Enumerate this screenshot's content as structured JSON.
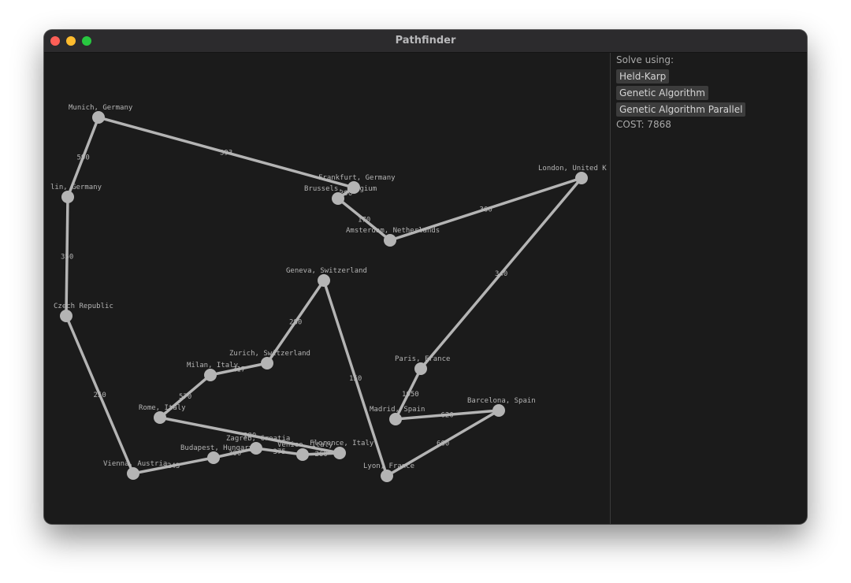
{
  "window": {
    "title": "Pathfinder"
  },
  "panel": {
    "solve_label": "Solve using:",
    "buttons": [
      "Held-Karp",
      "Genetic Algorithm",
      "Genetic Algorithm Parallel"
    ],
    "cost_text": "COST: 7868"
  },
  "graph": {
    "nodes": [
      {
        "id": "munich",
        "label": "Munich, Germany"
      },
      {
        "id": "berlin",
        "label": "lin, Germany"
      },
      {
        "id": "prague",
        "label": "Czech Republic"
      },
      {
        "id": "vienna",
        "label": "Vienna, Austria"
      },
      {
        "id": "budapest",
        "label": "Budapest, Hungary"
      },
      {
        "id": "zagreb",
        "label": "Zagreb, Croatia"
      },
      {
        "id": "venice",
        "label": "Venice, Italy"
      },
      {
        "id": "florence",
        "label": "Florence, Italy"
      },
      {
        "id": "rome",
        "label": "Rome, Italy"
      },
      {
        "id": "milan",
        "label": "Milan, Italy"
      },
      {
        "id": "zurich",
        "label": "Zurich, Switzerland"
      },
      {
        "id": "geneva",
        "label": "Geneva, Switzerland"
      },
      {
        "id": "lyon",
        "label": "Lyon, France"
      },
      {
        "id": "barcelona",
        "label": "Barcelona, Spain"
      },
      {
        "id": "madrid",
        "label": "Madrid, Spain"
      },
      {
        "id": "paris",
        "label": "Paris, France"
      },
      {
        "id": "london",
        "label": "London, United K"
      },
      {
        "id": "amsterdam",
        "label": "Amsterdam, Netherlands"
      },
      {
        "id": "brussels",
        "label": "Brussels, Belgium"
      },
      {
        "id": "frankfurt",
        "label": "Frankfurt, Germany"
      }
    ],
    "edges": [
      {
        "from": "munich",
        "to": "berlin",
        "weight": "590"
      },
      {
        "from": "berlin",
        "to": "prague",
        "weight": "350"
      },
      {
        "from": "prague",
        "to": "vienna",
        "weight": "250"
      },
      {
        "from": "vienna",
        "to": "budapest",
        "weight": "243"
      },
      {
        "from": "budapest",
        "to": "zagreb",
        "weight": "300"
      },
      {
        "from": "zagreb",
        "to": "venice",
        "weight": "375"
      },
      {
        "from": "venice",
        "to": "florence",
        "weight": "260"
      },
      {
        "from": "florence",
        "to": "rome",
        "weight": "280"
      },
      {
        "from": "rome",
        "to": "milan",
        "weight": "570"
      },
      {
        "from": "milan",
        "to": "zurich",
        "weight": "217"
      },
      {
        "from": "zurich",
        "to": "geneva",
        "weight": "280"
      },
      {
        "from": "geneva",
        "to": "lyon",
        "weight": "150"
      },
      {
        "from": "lyon",
        "to": "barcelona",
        "weight": "660"
      },
      {
        "from": "barcelona",
        "to": "madrid",
        "weight": "620"
      },
      {
        "from": "madrid",
        "to": "paris",
        "weight": "1050"
      },
      {
        "from": "paris",
        "to": "london",
        "weight": "340"
      },
      {
        "from": "london",
        "to": "amsterdam",
        "weight": "360"
      },
      {
        "from": "amsterdam",
        "to": "brussels",
        "weight": "170"
      },
      {
        "from": "brussels",
        "to": "frankfurt",
        "weight": "390"
      },
      {
        "from": "frankfurt",
        "to": "munich",
        "weight": "393"
      }
    ]
  }
}
